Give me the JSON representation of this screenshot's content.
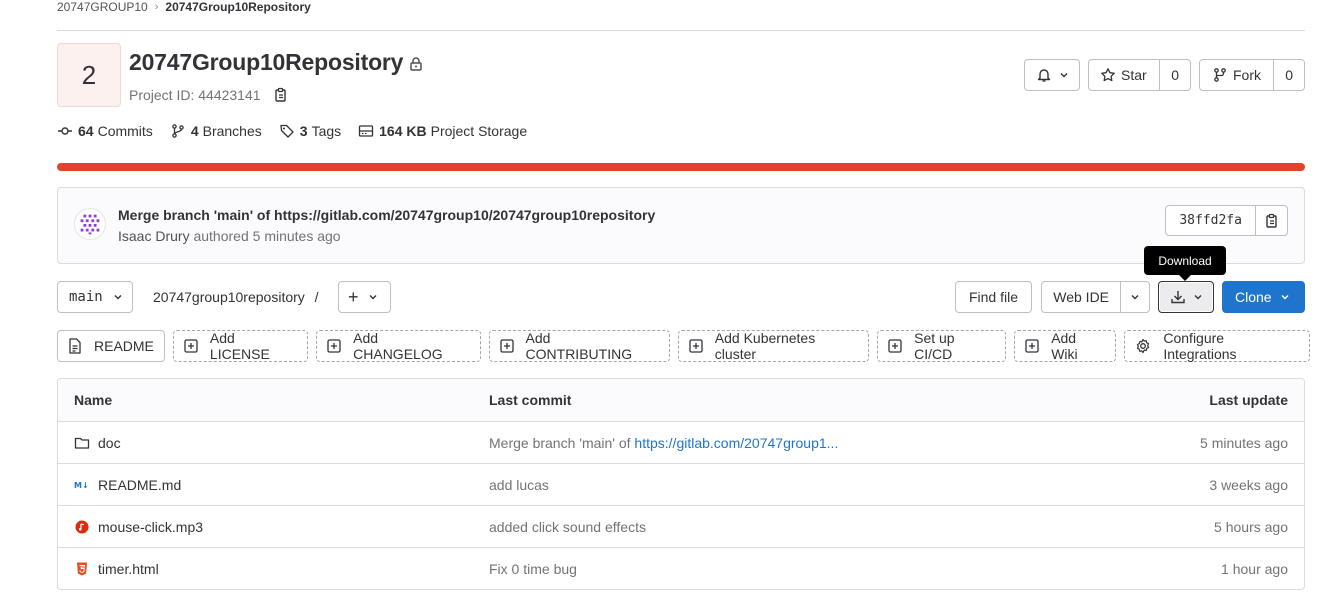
{
  "breadcrumb": {
    "group": "20747GROUP10",
    "separator": "›",
    "project": "20747Group10Repository"
  },
  "project": {
    "avatar_letter": "2",
    "title": "20747Group10Repository",
    "id_text": "Project ID: 44423141"
  },
  "actions": {
    "star_label": "Star",
    "star_count": "0",
    "fork_label": "Fork",
    "fork_count": "0"
  },
  "stats": {
    "commits_count": "64",
    "commits_label": "Commits",
    "branches_count": "4",
    "branches_label": "Branches",
    "tags_count": "3",
    "tags_label": "Tags",
    "storage_size": "164 KB",
    "storage_label": "Project Storage"
  },
  "language_bar_color": "#e24329",
  "last_commit": {
    "title": "Merge branch 'main' of https://gitlab.com/20747group10/20747group10repository",
    "author": "Isaac Drury",
    "authored_text": "authored",
    "time": "5 minutes ago",
    "sha": "38ffd2fa"
  },
  "toolbar": {
    "branch": "main",
    "path": "20747group10repository",
    "path_separator": "/",
    "add_label": "+",
    "find_file": "Find file",
    "web_ide": "Web IDE",
    "download_tooltip": "Download",
    "clone": "Clone"
  },
  "quick_actions": [
    {
      "label": "README",
      "style": "solid",
      "icon": "doc-icon"
    },
    {
      "label": "Add LICENSE",
      "style": "dashed",
      "icon": "plus-square-icon"
    },
    {
      "label": "Add CHANGELOG",
      "style": "dashed",
      "icon": "plus-square-icon"
    },
    {
      "label": "Add CONTRIBUTING",
      "style": "dashed",
      "icon": "plus-square-icon"
    },
    {
      "label": "Add Kubernetes cluster",
      "style": "dashed",
      "icon": "plus-square-icon"
    },
    {
      "label": "Set up CI/CD",
      "style": "dashed",
      "icon": "plus-square-icon"
    },
    {
      "label": "Add Wiki",
      "style": "dashed",
      "icon": "plus-square-icon"
    },
    {
      "label": "Configure Integrations",
      "style": "dashed",
      "icon": "gear-icon"
    }
  ],
  "table": {
    "headers": {
      "name": "Name",
      "last_commit": "Last commit",
      "last_update": "Last update"
    },
    "rows": [
      {
        "name": "doc",
        "icon": "folder-icon",
        "commit_prefix": "Merge branch 'main' of ",
        "commit_link": "https://gitlab.com/20747group1...",
        "updated": "5 minutes ago"
      },
      {
        "name": "README.md",
        "icon": "markdown-icon",
        "commit_prefix": "add lucas",
        "commit_link": "",
        "updated": "3 weeks ago"
      },
      {
        "name": "mouse-click.mp3",
        "icon": "audio-file-icon",
        "commit_prefix": "added click sound effects",
        "commit_link": "",
        "updated": "5 hours ago"
      },
      {
        "name": "timer.html",
        "icon": "html5-icon",
        "commit_prefix": "Fix 0 time bug",
        "commit_link": "",
        "updated": "1 hour ago"
      }
    ]
  }
}
